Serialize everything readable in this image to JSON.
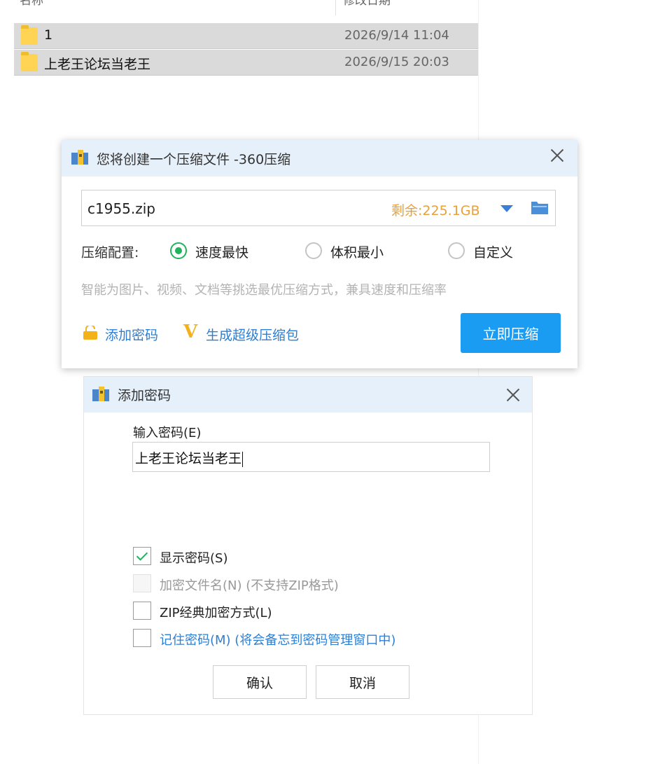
{
  "explorer": {
    "col_name": "名称",
    "col_date": "修改日期",
    "rows": [
      {
        "name": "1",
        "date": "2026/9/14 11:04"
      },
      {
        "name": "上老王论坛当老王",
        "date": "2026/9/15 20:03"
      }
    ]
  },
  "create_dialog": {
    "title": "您将创建一个压缩文件 -360压缩",
    "filename": "c1955.zip",
    "free_space": "剩余:225.1GB",
    "config_label": "压缩配置:",
    "options": [
      {
        "label": "速度最快",
        "selected": true
      },
      {
        "label": "体积最小",
        "selected": false
      },
      {
        "label": "自定义",
        "selected": false
      }
    ],
    "hint": "智能为图片、视频、文档等挑选最优压缩方式，兼具速度和压缩率",
    "add_password_link": "添加密码",
    "super_package_link": "生成超级压缩包",
    "compress_button": "立即压缩",
    "accent_color": "#1a9cf2"
  },
  "password_dialog": {
    "title": "添加密码",
    "input_label": "输入密码(E)",
    "password_value": "上老王论坛当老王",
    "checkboxes": [
      {
        "label": "显示密码(S)",
        "checked": true,
        "disabled": false
      },
      {
        "label": "加密文件名(N) (不支持ZIP格式)",
        "checked": false,
        "disabled": true
      },
      {
        "label": "ZIP经典加密方式(L)",
        "checked": false,
        "disabled": false
      },
      {
        "label": "记住密码(M) (将会备忘到密码管理窗口中)",
        "checked": false,
        "disabled": false
      }
    ],
    "ok_button": "确认",
    "cancel_button": "取消"
  }
}
